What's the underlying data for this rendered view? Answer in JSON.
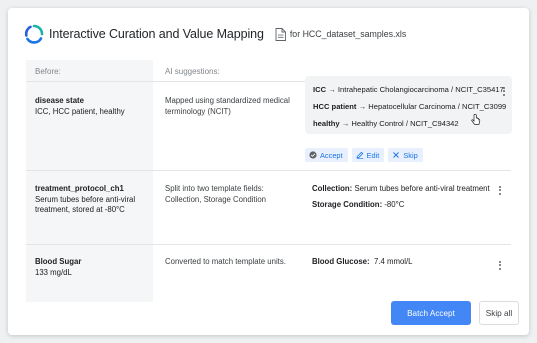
{
  "header": {
    "title": "Interactive Curation and Value Mapping",
    "file_label": "for HCC_dataset_samples.xls"
  },
  "table": {
    "col_before": "Before:",
    "col_ai": "AI suggestions:"
  },
  "rows": [
    {
      "field": "disease state",
      "value": "ICC, HCC patient, healthy",
      "suggestion": "Mapped using standardized medical terminology (NCIT)",
      "mappings": [
        {
          "source": "ICC",
          "target": " → Intrahepatic Cholangiocarcinoma / NCIT_C35417"
        },
        {
          "source": "HCC patient",
          "target": " → Hepatocellular Carcinoma / NCIT_C3099"
        },
        {
          "source": "healthy",
          "target": " → Healthy Control / NCIT_C94342"
        }
      ],
      "actions": {
        "accept": "Accept",
        "edit": "Edit",
        "skip": "Skip"
      }
    },
    {
      "field": "treatment_protocol_ch1",
      "value": "Serum tubes before anti-viral treatment, stored at -80°C",
      "suggestion": "Split into two template fields: Collection, Storage Condition",
      "results": [
        {
          "key": "Collection:",
          "val": " Serum tubes before anti-viral treatment"
        },
        {
          "key": "Storage Condition:",
          "val": " -80°C"
        }
      ]
    },
    {
      "field": "Blood Sugar",
      "value": "133 mg/dL",
      "suggestion": "Converted to match template units.",
      "results": [
        {
          "key": "Blood Glucose:",
          "val": "  7.4 mmol/L"
        }
      ]
    }
  ],
  "buttons": {
    "batch_accept": "Batch Accept",
    "skip_all": "Skip all"
  },
  "colors": {
    "primary": "#4287f5",
    "chip_text": "#1a73e8",
    "chip_bg": "#e8f0fe",
    "logo_blue": "#1a73e8",
    "logo_teal": "#1bb3a9"
  }
}
